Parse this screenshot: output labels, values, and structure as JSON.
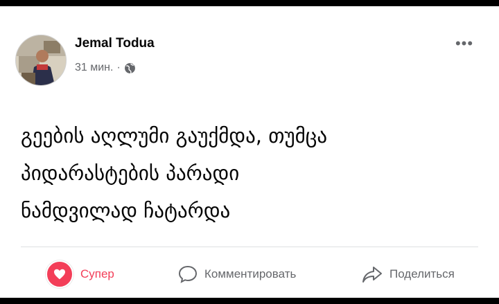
{
  "post": {
    "author": "Jemal Todua",
    "time": "31 мин.",
    "separator": "·",
    "text": "გეების აღლუმი გაუქმდა, თუმცა\nპიდარასტების პარადი\nნამდვილად ჩატარდა",
    "menu_label": "•••"
  },
  "actions": {
    "react_label": "Супер",
    "comment_label": "Комментировать",
    "share_label": "Поделиться"
  },
  "icons": {
    "privacy": "globe-icon",
    "react": "heart-icon",
    "comment": "comment-icon",
    "share": "share-arrow-icon"
  },
  "colors": {
    "react": "#f33e58",
    "secondary_text": "#65676b",
    "primary_text": "#050505"
  }
}
